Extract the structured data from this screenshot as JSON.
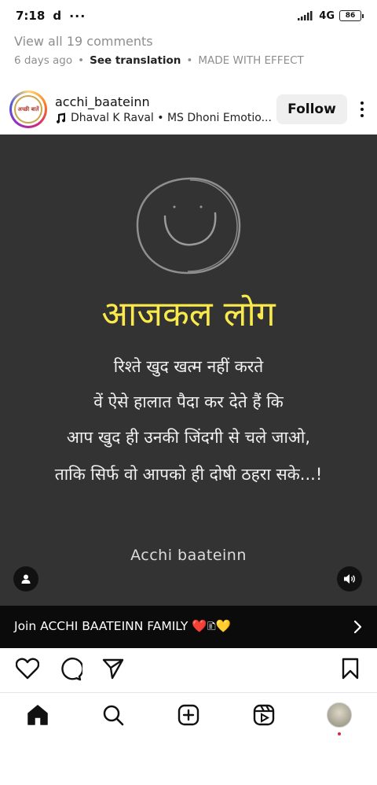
{
  "status": {
    "time": "7:18",
    "carrier_glyph": "d",
    "dots": "···",
    "network": "4G",
    "battery": "86"
  },
  "prev_post": {
    "view_comments": "View all 19 comments",
    "age": "6 days ago",
    "see_translation": "See translation",
    "made_with": "MADE WITH EFFECT"
  },
  "post": {
    "username": "acchi_baateinn",
    "avatar_text": "अच्छी बातें",
    "audio": "Dhaval K Raval • MS Dhoni Emotio...",
    "follow_label": "Follow",
    "media": {
      "headline": "आजकल लोग",
      "lines": [
        "रिश्ते खुद खत्म नहीं करते",
        "वें ऐसे हालात पैदा कर देते हैं कि",
        "आप खुद ही उनकी जिंदगी से चले जाओ,",
        "ताकि सिर्फ वो आपको ही दोषी ठहरा सके...!"
      ],
      "watermark": "Acchi baateinn"
    },
    "join_banner": "Join ACCHI BAATEINN FAMILY ❤️🗈💛"
  },
  "icons": {
    "signal": "signal-icon",
    "battery": "battery-icon",
    "music": "music-note-icon",
    "user_tag": "user-tag-icon",
    "audio": "speaker-icon",
    "like": "heart-icon",
    "comment": "comment-icon",
    "share": "send-icon",
    "save": "bookmark-icon",
    "home": "home-icon",
    "search": "search-icon",
    "create": "add-post-icon",
    "reels": "reels-icon",
    "profile": "profile-avatar"
  },
  "colors": {
    "media_bg": "#333333",
    "headline": "#f9e94b",
    "banner_bg": "#0b0b0b",
    "follow_bg": "#efefef",
    "notification_dot": "#e0243f"
  }
}
